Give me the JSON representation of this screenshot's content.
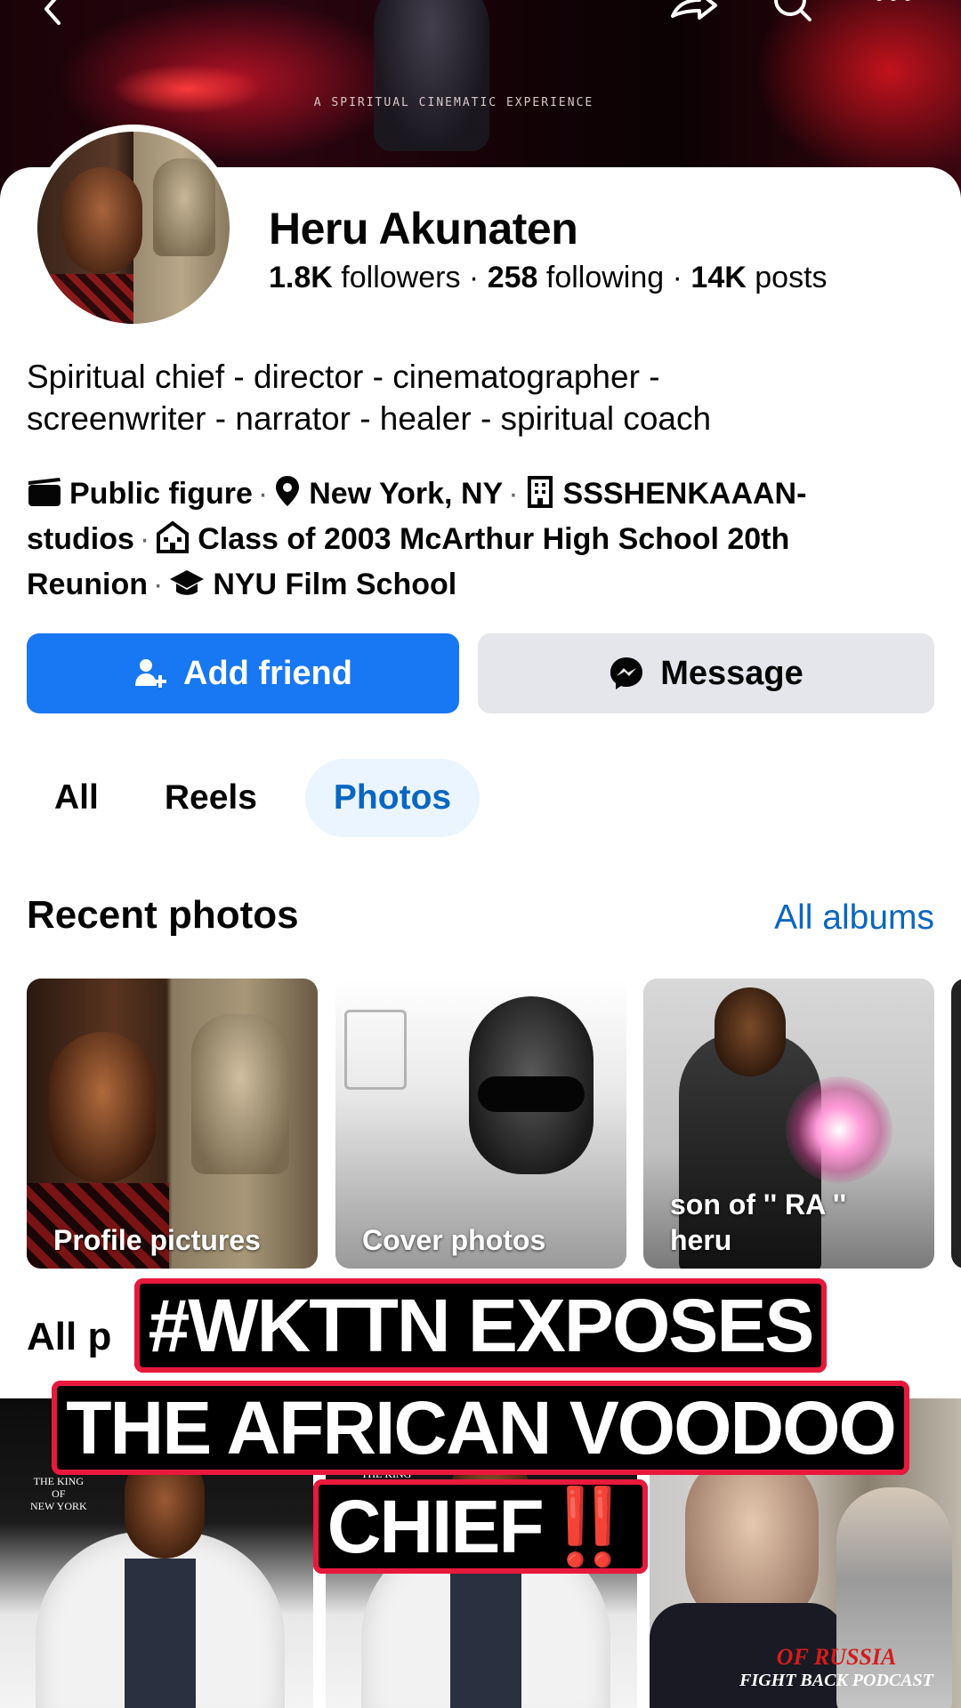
{
  "cover": {
    "tagline": "A SPIRITUAL CINEMATIC EXPERIENCE",
    "colors": {
      "primary": "#b0121c",
      "dark": "#12030a"
    }
  },
  "topbar": {
    "icons": [
      "back-icon",
      "share-icon",
      "search-icon",
      "more-icon"
    ]
  },
  "profile": {
    "name": "Heru Akunaten",
    "followers_count": "1.8K",
    "followers_label": "followers",
    "following_count": "258",
    "following_label": "following",
    "posts_count": "14K",
    "posts_label": "posts",
    "bio_line1": "Spiritual chief - director - cinematographer -",
    "bio_line2": "screenwriter - narrator - healer - spiritual coach",
    "details": {
      "category": "Public figure",
      "location": "New York, NY",
      "work_part1": "SSSHENKAAAN-",
      "work_part2": "studios",
      "school": "Class of 2003 McArthur High School 20th",
      "school_cont": "Reunion",
      "college": "NYU Film School"
    }
  },
  "actions": {
    "add_friend": "Add friend",
    "message": "Message",
    "colors": {
      "primary": "#1877f2",
      "secondary": "#e4e6eb"
    }
  },
  "tabs": [
    {
      "label": "All",
      "active": false
    },
    {
      "label": "Reels",
      "active": false
    },
    {
      "label": "Photos",
      "active": true
    }
  ],
  "recent_photos": {
    "title": "Recent photos",
    "all_albums": "All albums",
    "albums": [
      {
        "label": "Profile pictures"
      },
      {
        "label": "Cover photos"
      },
      {
        "label_line1": "son of '' RA ''",
        "label_line2": "heru"
      }
    ]
  },
  "all_photos": {
    "title_visible": "All p",
    "grid": [
      {
        "overlay_text_top": "THE KING",
        "overlay_text_mid": "OF",
        "overlay_text_bottom": "NEW YORK"
      },
      {
        "overlay_text_top": "THE KING"
      },
      {
        "overlay_line1": "OF RUSSIA",
        "overlay_line2": "FIGHT BACK PODCAST"
      }
    ]
  },
  "caption": {
    "line1": "#WKTTN EXPOSES",
    "line2": "THE AFRICAN VOODOO",
    "line3": "CHIEF",
    "emphasis": "‼️",
    "colors": {
      "border": "#e8193c",
      "fill": "#000000",
      "text": "#ffffff"
    }
  }
}
